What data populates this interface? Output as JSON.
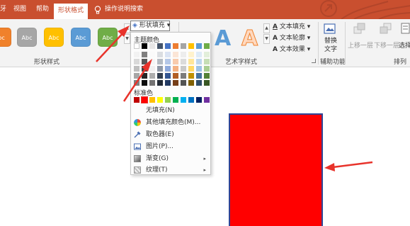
{
  "tabs": [
    "牙",
    "视图",
    "帮助",
    "形状格式",
    "操作说明搜索"
  ],
  "ribbon": {
    "shape_styles": {
      "label": "形状样式",
      "buttons": [
        {
          "text": "bc",
          "color": "#f0812b"
        },
        {
          "text": "Abc",
          "color": "#a6a6a6"
        },
        {
          "text": "Abc",
          "color": "#ffc000"
        },
        {
          "text": "Abc",
          "color": "#5b9bd5"
        },
        {
          "text": "Abc",
          "color": "#70ad47"
        }
      ],
      "more_up": "▲",
      "more_down": "▼"
    },
    "fill_button": "形状填充",
    "wordart": {
      "label": "艺术字样式",
      "glyphs": [
        "A",
        "A"
      ],
      "text_fill": "文本填充",
      "text_outline": "文本轮廓",
      "text_effect": "文本效果"
    },
    "alt_text": {
      "line1": "替换",
      "line2": "文字",
      "group": "辅助功能"
    },
    "arrange": {
      "bring_forward": "上移一层",
      "send_backward": "下移一层",
      "select": "选择",
      "group": "排列"
    }
  },
  "dropdown": {
    "theme_colors_label": "主题颜色",
    "theme_top_row": [
      "#ffffff",
      "#000000",
      "#e7e6e6",
      "#44546a",
      "#4472c4",
      "#ed7d31",
      "#a5a5a5",
      "#ffc000",
      "#5b9bd5",
      "#70ad47"
    ],
    "standard_colors_label": "标准色",
    "standard_colors": [
      "#c00000",
      "#ff0000",
      "#ffc000",
      "#ffff00",
      "#92d050",
      "#00b050",
      "#00b0f0",
      "#0070c0",
      "#002060",
      "#7030a0"
    ],
    "items": [
      {
        "label": "无填充(N)",
        "icon": "no-fill-icon",
        "submenu": false
      },
      {
        "label": "其他填充颜色(M)...",
        "icon": "color-wheel-icon",
        "submenu": false
      },
      {
        "label": "取色器(E)",
        "icon": "eyedropper-icon",
        "submenu": false
      },
      {
        "label": "图片(P)...",
        "icon": "picture-icon",
        "submenu": false
      },
      {
        "label": "渐变(G)",
        "icon": "gradient-icon",
        "submenu": true
      },
      {
        "label": "纹理(T)",
        "icon": "texture-icon",
        "submenu": true
      }
    ]
  },
  "canvas": {
    "shape_fill": "#ff0000",
    "shape_outline": "#2f4596"
  },
  "annotation_color": "#e8332b"
}
